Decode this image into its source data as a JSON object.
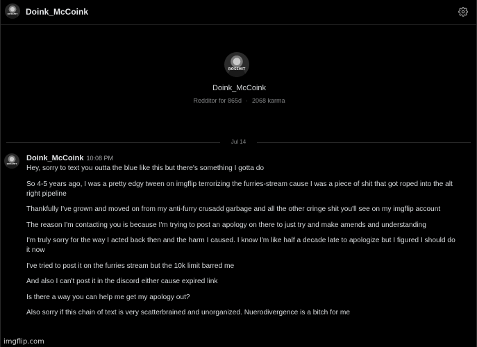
{
  "header": {
    "username": "Doink_McCoink",
    "avatar_icon": "user-avatar-icon",
    "settings_icon": "gear-icon"
  },
  "avatar_tag": "ROSSHIT",
  "profile": {
    "name": "Doink_McCoink",
    "tenure": "Redditor for 865d",
    "separator": "·",
    "karma": "2068 karma"
  },
  "date_divider": "Jul 14",
  "message": {
    "author": "Doink_McCoink",
    "time": "10:08 PM",
    "paragraphs": [
      "Hey, sorry to text you outta the blue like this but there's something I gotta do",
      "So 4-5 years ago, I was a pretty edgy tween on imgflip terrorizing the furries-stream cause I was a piece of shit that got roped into the alt right pipeline",
      "Thankfully I've grown and moved on from my anti-furry crusadd garbage and all the other cringe shit you'll see on my imgflip account",
      "The reason I'm contacting you is because I'm trying to post an apology on there to just try and make amends and understanding",
      "I'm truly sorry for the way I acted back then and the harm I caused. I know I'm like half a decade late to apologize but I figured I should do it now",
      "I've tried to post it on the furries stream but the 10k limit barred me",
      "And also I can't post it in the discord either cause expired link",
      "Is there a way you can help me get my apology out?",
      "Also sorry if this chain of text is very scatterbrained and unorganized. Nuerodivergence is a bitch for me"
    ]
  },
  "watermark": "imgflip.com",
  "colors": {
    "background": "#000000",
    "text_primary": "#d7dadc",
    "text_secondary": "#818384"
  }
}
